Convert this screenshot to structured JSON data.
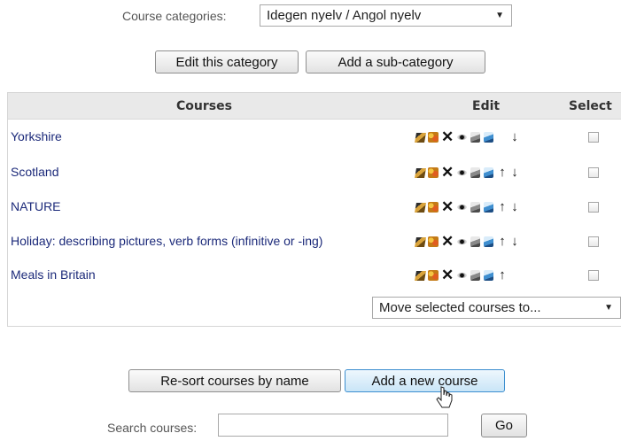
{
  "category": {
    "label": "Course categories:",
    "selected": "Idegen nyelv / Angol nyelv"
  },
  "buttons": {
    "edit_category": "Edit this category",
    "add_subcategory": "Add a sub-category",
    "resort": "Re-sort courses by name",
    "add_course": "Add a new course",
    "go": "Go"
  },
  "table": {
    "headers": {
      "courses": "Courses",
      "edit": "Edit",
      "select": "Select"
    },
    "rows": [
      {
        "name": "Yorkshire",
        "up": false,
        "down": true
      },
      {
        "name": "Scotland",
        "up": true,
        "down": true
      },
      {
        "name": "NATURE",
        "up": true,
        "down": true
      },
      {
        "name": "Holiday: describing pictures, verb forms (infinitive or -ing)",
        "up": true,
        "down": true
      },
      {
        "name": "Meals in Britain",
        "up": true,
        "down": false
      }
    ],
    "icons": [
      "edit-icon",
      "assign-roles-icon",
      "delete-icon",
      "hide-eye-icon",
      "backup-icon",
      "restore-icon",
      "move-up-icon",
      "move-down-icon"
    ]
  },
  "move_select": {
    "selected": "Move selected courses to..."
  },
  "search": {
    "label": "Search courses:",
    "value": ""
  }
}
